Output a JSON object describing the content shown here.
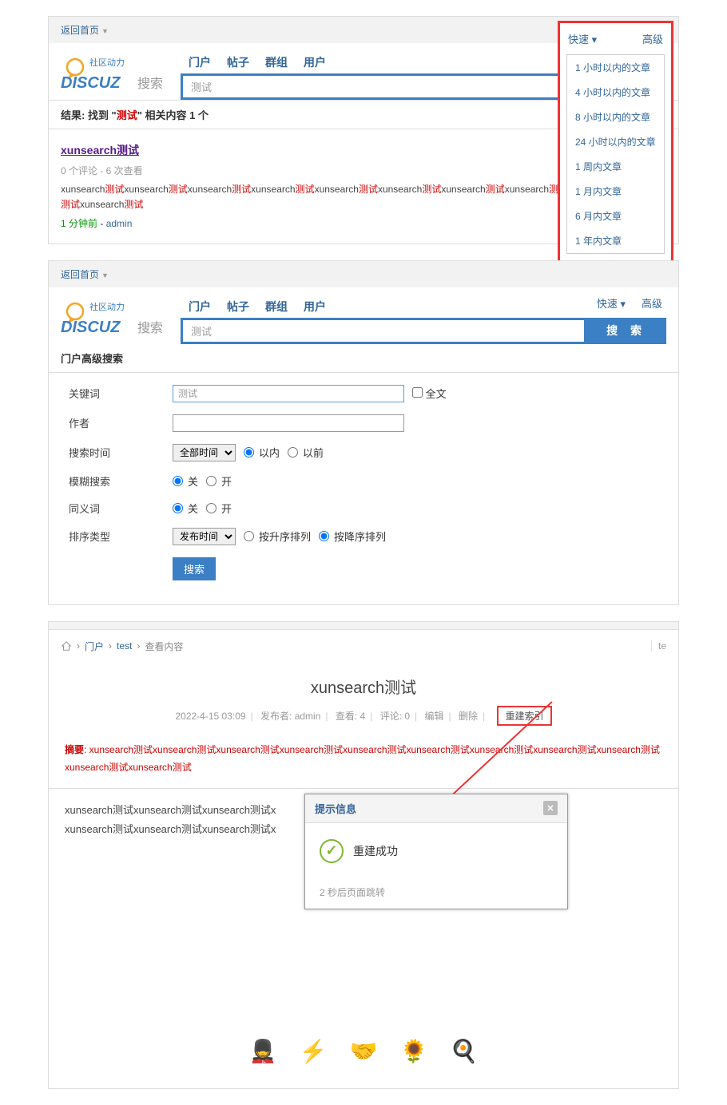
{
  "topbar": {
    "home": "返回首页"
  },
  "logo": {
    "line1": "社区动力",
    "brand": "DISCUZ",
    "sub": "搜索"
  },
  "tabs": {
    "portal": "门户",
    "post": "帖子",
    "group": "群组",
    "user": "用户"
  },
  "quick": {
    "fast": "快速",
    "advanced": "高级"
  },
  "search_input": "测试",
  "search_button": "搜 索",
  "dropdown": [
    "1 小时以内的文章",
    "4 小时以内的文章",
    "8 小时以内的文章",
    "24 小时以内的文章",
    "1 周内文章",
    "1 月内文章",
    "6 月内文章",
    "1 年内文章"
  ],
  "result_header": {
    "prefix": "结果: 找到 \"",
    "term": "测试",
    "suffix": "\" 相关内容 1 个"
  },
  "result": {
    "title": "xunsearch测试",
    "meta": "0 个评论 - 6 次查看",
    "time": "1 分钟前",
    "admin": "admin"
  },
  "snippet_word": "xunsearch",
  "snippet_hl": "测试",
  "adv_title": "门户高级搜索",
  "form": {
    "keyword_label": "关键词",
    "keyword_value": "测试",
    "fulltext": "全文",
    "author_label": "作者",
    "time_label": "搜索时间",
    "time_value": "全部时间",
    "within": "以内",
    "before": "以前",
    "fuzzy_label": "模糊搜索",
    "off": "关",
    "on": "开",
    "synonym_label": "同义词",
    "sort_label": "排序类型",
    "sort_value": "发布时间",
    "asc": "按升序排列",
    "desc": "按降序排列",
    "submit": "搜索"
  },
  "breadcrumb": {
    "portal": "门户",
    "sep": "›",
    "test": "test",
    "view": "查看内容"
  },
  "article": {
    "title": "xunsearch测试",
    "date": "2022-4-15 03:09",
    "publisher_label": "发布者: ",
    "publisher": "admin",
    "views_label": "查看: ",
    "views": "4",
    "comments_label": "评论: ",
    "comments": "0",
    "edit": "编辑",
    "delete": "删除",
    "rebuild": "重建索引",
    "summary_label": "摘要",
    "summary_text": ": xunsearch测试xunsearch测试xunsearch测试xunsearch测试xunsearch测试xunsearch测试xunsearch测试xunsearch测试xunsearch测试xunsearch测试xunsearch测试",
    "body1": "xunsearch测试xunsearch测试xunsearch测试x",
    "body2": "xunsearch测试xunsearch测试xunsearch测试x"
  },
  "dialog": {
    "title": "提示信息",
    "message": "重建成功",
    "footer": "2 秒后页面跳转"
  },
  "sidebar_hint": "te"
}
